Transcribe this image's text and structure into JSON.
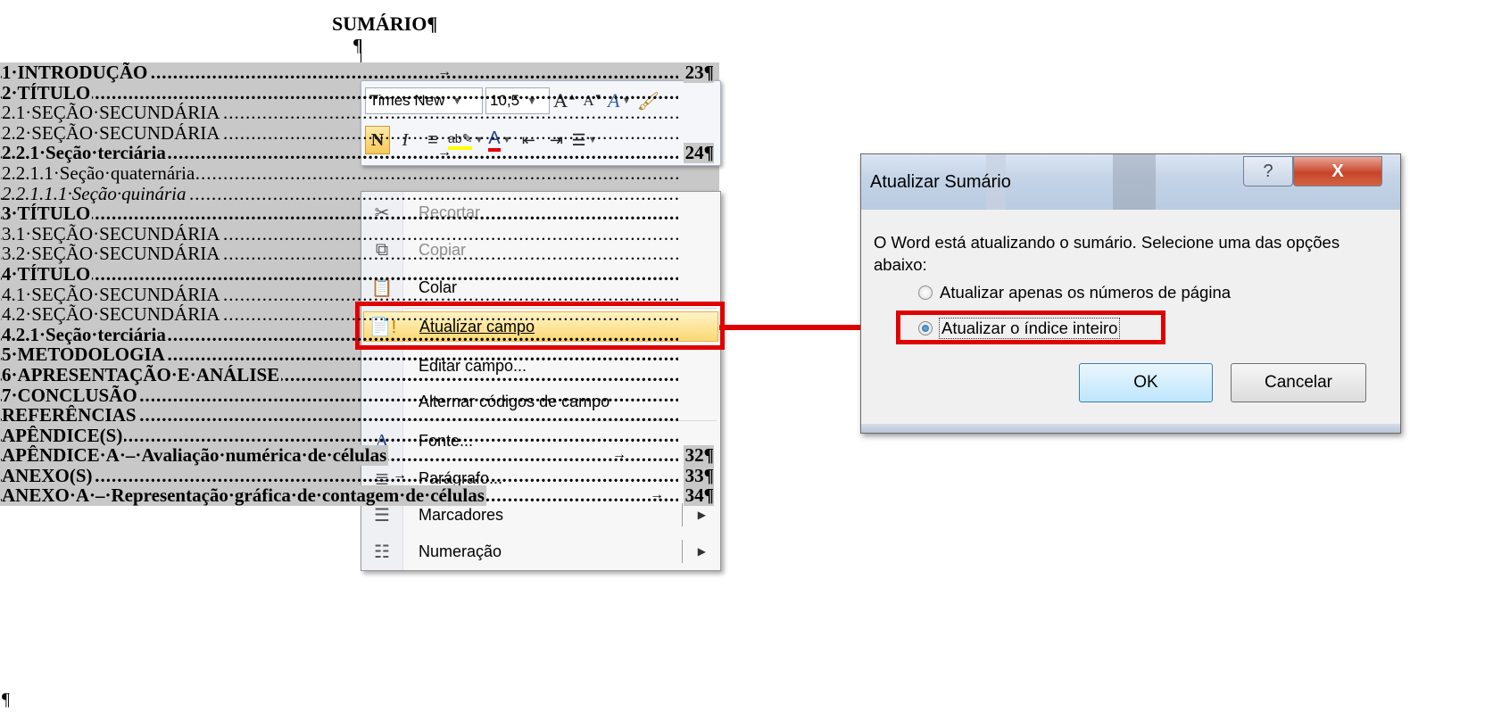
{
  "document": {
    "title": "SUMÁRIO¶",
    "empty_paragraph": "¶",
    "toc": [
      {
        "text": "1·INTRODUÇÃO",
        "page": "23¶",
        "style": "bold",
        "tab": true
      },
      {
        "text": "2·TÍTULO",
        "page": "",
        "style": "bold"
      },
      {
        "text": "2.1·SEÇÃO·SECUNDÁRIA",
        "page": "",
        "style": "normal"
      },
      {
        "text": "2.2·SEÇÃO·SECUNDÁRIA",
        "page": "",
        "style": "normal"
      },
      {
        "text": "2.2.1·Seção·terciária",
        "page": "24¶",
        "style": "bold",
        "tab": true
      },
      {
        "text": "2.2.1.1·Seção·quaternária",
        "page": "",
        "style": "normal"
      },
      {
        "text": "2.2.1.1.1·Seção·quinária",
        "page": "",
        "style": "italic"
      },
      {
        "text": "3·TÍTULO",
        "page": "",
        "style": "bold"
      },
      {
        "text": "3.1·SEÇÃO·SECUNDÁRIA",
        "page": "",
        "style": "normal"
      },
      {
        "text": "3.2·SEÇÃO·SECUNDÁRIA",
        "page": "",
        "style": "normal"
      },
      {
        "text": "4·TÍTULO",
        "page": "",
        "style": "bold"
      },
      {
        "text": "4.1·SEÇÃO·SECUNDÁRIA",
        "page": "",
        "style": "normal"
      },
      {
        "text": "4.2·SEÇÃO·SECUNDÁRIA",
        "page": "",
        "style": "normal"
      },
      {
        "text": "4.2.1·Seção·terciária",
        "page": "",
        "style": "bold"
      },
      {
        "text": "5·METODOLOGIA",
        "page": "",
        "style": "bold"
      },
      {
        "text": "6·APRESENTAÇÃO·E·ANÁLISE",
        "page": "",
        "style": "bold"
      },
      {
        "text": "7·CONCLUSÃO",
        "page": "",
        "style": "bold"
      },
      {
        "text": "REFERÊNCIAS",
        "page": "",
        "style": "bold"
      },
      {
        "text": "APÊNDICE(S)",
        "page": "",
        "style": "bold"
      },
      {
        "text": "APÊNDICE·A·–·Avaliação·numérica·de·células",
        "page": "32¶",
        "style": "bold",
        "tab": true
      },
      {
        "text": "ANEXO(S)",
        "page": "33¶",
        "style": "bold",
        "tab": true
      },
      {
        "text": "ANEXO·A·–·Representação·gráfica·de·contagem·de·células",
        "page": "34¶",
        "style": "bold",
        "tab": true
      }
    ],
    "end_mark": "¶"
  },
  "mini_toolbar": {
    "font_name": "Times New",
    "font_size": "10,5",
    "bold": "N",
    "italic": "I"
  },
  "context_menu": {
    "items": [
      {
        "label": "Recortar",
        "icon": "scissors-icon",
        "disabled": true
      },
      {
        "label": "Copiar",
        "icon": "copy-icon",
        "disabled": true
      },
      {
        "label": "Colar",
        "icon": "paste-icon",
        "disabled": false
      },
      {
        "label": "Atualizar campo",
        "icon": "update-field-icon",
        "disabled": false,
        "highlighted": true
      },
      {
        "label": "Editar campo...",
        "icon": "",
        "disabled": false
      },
      {
        "label": "Alternar códigos de campo",
        "icon": "",
        "disabled": false
      },
      {
        "label": "Fonte...",
        "icon": "font-icon",
        "disabled": false
      },
      {
        "label": "Parágrafo...",
        "icon": "paragraph-icon",
        "disabled": false
      },
      {
        "label": "Marcadores",
        "icon": "bullets-icon",
        "disabled": false,
        "submenu": true
      },
      {
        "label": "Numeração",
        "icon": "numbering-icon",
        "disabled": false,
        "submenu": true
      }
    ]
  },
  "dialog": {
    "title": "Atualizar Sumário",
    "help_glyph": "?",
    "close_glyph": "X",
    "message": "O Word está atualizando o sumário. Selecione uma das opções abaixo:",
    "option_1": "Atualizar apenas os números de página",
    "option_2": "Atualizar o índice inteiro",
    "ok_label": "OK",
    "cancel_label": "Cancelar"
  },
  "colors": {
    "highlight_red": "#e00000",
    "toc_field_shading": "#c8c8c8",
    "menu_hover": "#fbd873"
  }
}
